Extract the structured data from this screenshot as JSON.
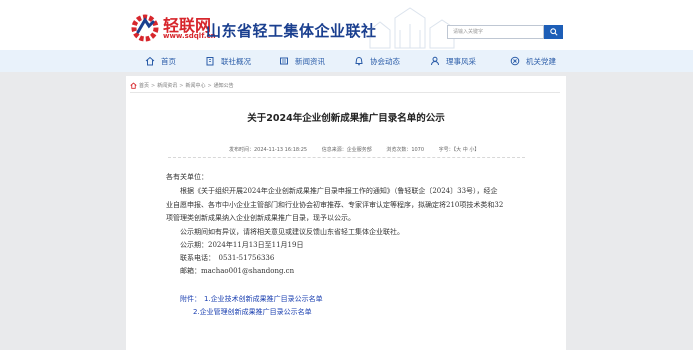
{
  "header": {
    "logo_cn": "轻联网",
    "logo_url": "www.sdqlf.cn",
    "org_name": "山东省轻工集体企业联社",
    "search_placeholder": "请输入关键字"
  },
  "nav": [
    {
      "label": "首页",
      "icon": "home-icon"
    },
    {
      "label": "联社概况",
      "icon": "building-icon"
    },
    {
      "label": "新闻资讯",
      "icon": "news-icon"
    },
    {
      "label": "协会动态",
      "icon": "bell-icon"
    },
    {
      "label": "理事风采",
      "icon": "person-icon"
    },
    {
      "label": "机关党建",
      "icon": "party-icon"
    }
  ],
  "breadcrumb": [
    "首页",
    "新闻资讯",
    "新闻中心",
    "通知公告"
  ],
  "article": {
    "title": "关于2024年企业创新成果推广目录名单的公示",
    "meta": {
      "publish_time": "发布时间：2024-11-13 16:18:25",
      "source": "信息来源：企业服务部",
      "views": "浏览次数：1070",
      "font_size": "字号：【大 中 小】"
    },
    "salutation": "各有关单位：",
    "paragraph_lines": [
      "根据《关于组织开展2024年企业创新成果推广目录申报工作的通知》（鲁轻联企〔2024〕33号），经企",
      "业自愿申报、各市中小企业主管部门和行业协会初审推荐、专家评审认定等程序，拟确定将210项技术类和32",
      "项管理类创新成果纳入企业创新成果推广目录，现予以公示。"
    ],
    "objection": "公示期间如有异议，请将相关意见或建议反馈山东省轻工集体企业联社。",
    "period": "公示期：2024年11月13日至11月19日",
    "phone": "联系电话：　0531-51756336",
    "email": "邮箱：machao001@shandong.cn",
    "attachments_label": "附件：",
    "attachments": [
      "1.企业技术创新成果推广目录公示名单",
      "2.企业管理创新成果推广目录公示名单"
    ]
  }
}
